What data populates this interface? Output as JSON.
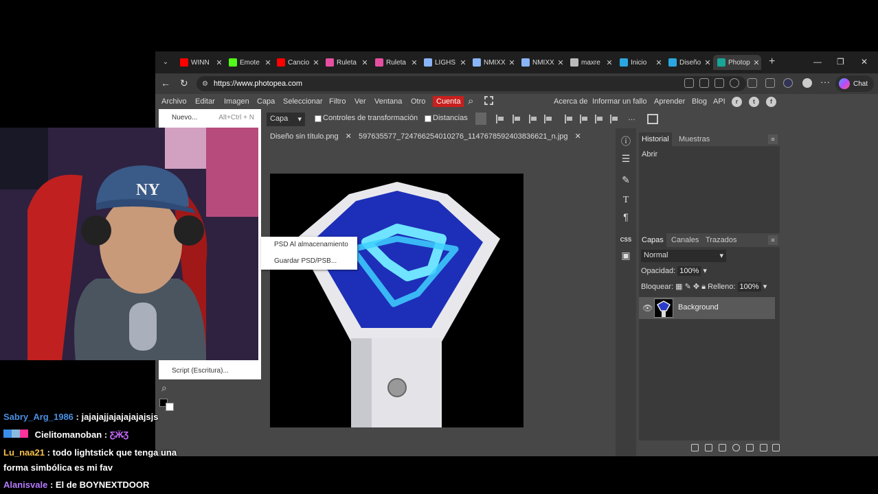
{
  "browser": {
    "tabs": [
      {
        "title": "WINN",
        "icon": "youtube-icon",
        "color": "#ff0000"
      },
      {
        "title": "Emote",
        "icon": "kick-icon",
        "color": "#53fc18"
      },
      {
        "title": "Cancio",
        "icon": "youtube-icon",
        "color": "#ff0000"
      },
      {
        "title": "Ruleta",
        "icon": "wheel-icon",
        "color": "#e64fa0"
      },
      {
        "title": "Ruleta",
        "icon": "wheel-icon",
        "color": "#e64fa0"
      },
      {
        "title": "LIGHS",
        "icon": "search-icon",
        "color": "#8ab4f8"
      },
      {
        "title": "NMIXX",
        "icon": "search-icon",
        "color": "#8ab4f8"
      },
      {
        "title": "NMIXX",
        "icon": "search-icon",
        "color": "#8ab4f8"
      },
      {
        "title": "maxre",
        "icon": "globe-icon",
        "color": "#bbbbbb"
      },
      {
        "title": "Inicio",
        "icon": "canva-icon",
        "color": "#2aa7e0"
      },
      {
        "title": "Diseño",
        "icon": "canva-icon",
        "color": "#2aa7e0"
      },
      {
        "title": "Photop",
        "icon": "photopea-icon",
        "color": "#18a497"
      }
    ],
    "url": "https://www.photopea.com",
    "chat_label": "Chat"
  },
  "menu": {
    "items": [
      "Archivo",
      "Editar",
      "Imagen",
      "Capa",
      "Seleccionar",
      "Filtro",
      "Ver",
      "Ventana",
      "Otro",
      "Cuenta"
    ],
    "right_items": [
      "Acerca de",
      "Informar un fallo",
      "Aprender",
      "Blog",
      "API"
    ]
  },
  "options": {
    "layer_select": "Capa",
    "transform_controls": "Controles de transformación",
    "distances": "Distancias"
  },
  "documents": [
    "Diseño sin título.png",
    "597635577_724766254010276_1147678592403836621_n.jpg"
  ],
  "file_menu": {
    "items": [
      {
        "label": "Nuevo...",
        "shortcut": "Alt+Ctrl + N"
      },
      {
        "label": "Script (Escritura)...",
        "shortcut": ""
      }
    ]
  },
  "submenu": {
    "items": [
      "PSD Al almacenamiento",
      "Guardar PSD/PSB..."
    ]
  },
  "history_panel": {
    "tabs": [
      "Historial",
      "Muestras"
    ],
    "entries": [
      "Abrir"
    ]
  },
  "layers_panel": {
    "tabs": [
      "Capas",
      "Canales",
      "Trazados"
    ],
    "blend_mode": "Normal",
    "opacity_label": "Opacidad:",
    "opacity_value": "100%",
    "lock_label": "Bloquear:",
    "fill_label": "Relleno:",
    "fill_value": "100%",
    "layers": [
      {
        "name": "Background"
      }
    ]
  },
  "toolstrip": {
    "css_label": "CSS"
  },
  "chat": {
    "messages": [
      {
        "user": "Sabry_Arg_1986",
        "user_color": "#4a90e2",
        "text": "jajajajjajajajajajsjs"
      },
      {
        "user": "Cielitomanoban",
        "user_color": "#ffffff",
        "text": ""
      },
      {
        "user": "Lu_naa21",
        "user_color": "#f5c04a",
        "text": "todo lightstick que tenga una"
      },
      {
        "user": "",
        "user_color": "#ffffff",
        "text": "forma simbólica es mi fav"
      },
      {
        "user": "Alanisvale",
        "user_color": "#b57cff",
        "text": "El de BOYNEXTDOOR"
      }
    ]
  }
}
